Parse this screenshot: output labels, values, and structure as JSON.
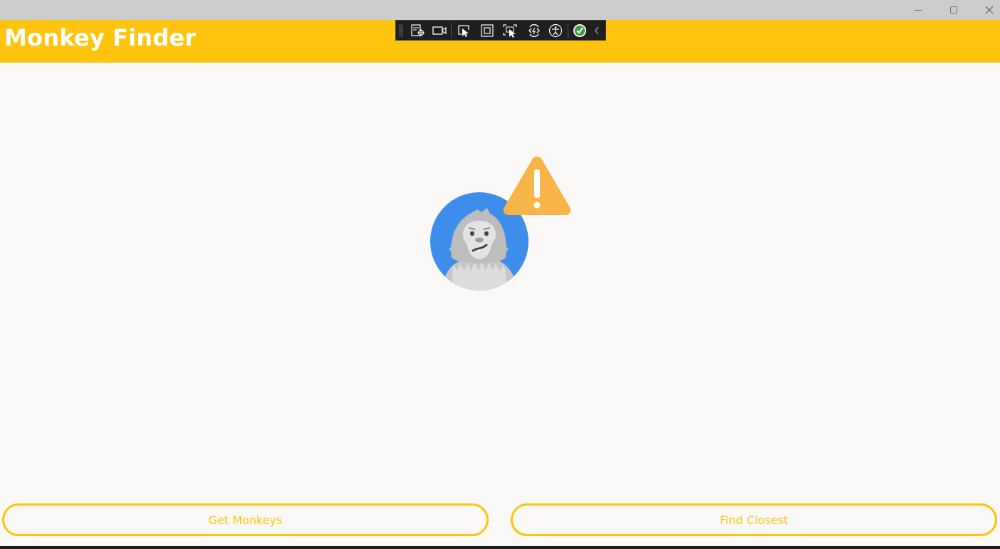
{
  "app": {
    "title": "Monkey Finder"
  },
  "window_controls": {
    "minimize_icon": "minimize-icon",
    "maximize_icon": "maximize-icon",
    "close_icon": "close-icon"
  },
  "debug_toolbar": {
    "items": [
      "live-visual-tree-icon",
      "record-icon",
      "select-element-icon",
      "display-layout-adorners-icon",
      "track-focus-icon",
      "hot-reload-icon",
      "accessibility-icon",
      "status-ok-icon",
      "collapse-chevron-icon"
    ]
  },
  "empty_view": {
    "image": "monkey-warning-illustration"
  },
  "buttons": {
    "get_monkeys": "Get Monkeys",
    "find_closest": "Find Closest"
  },
  "colors": {
    "accent": "#ffc40d",
    "background": "#faf9f8",
    "titlebar": "#cccccc",
    "warning": "#f7b549",
    "avatar_bg": "#3d8eea"
  }
}
